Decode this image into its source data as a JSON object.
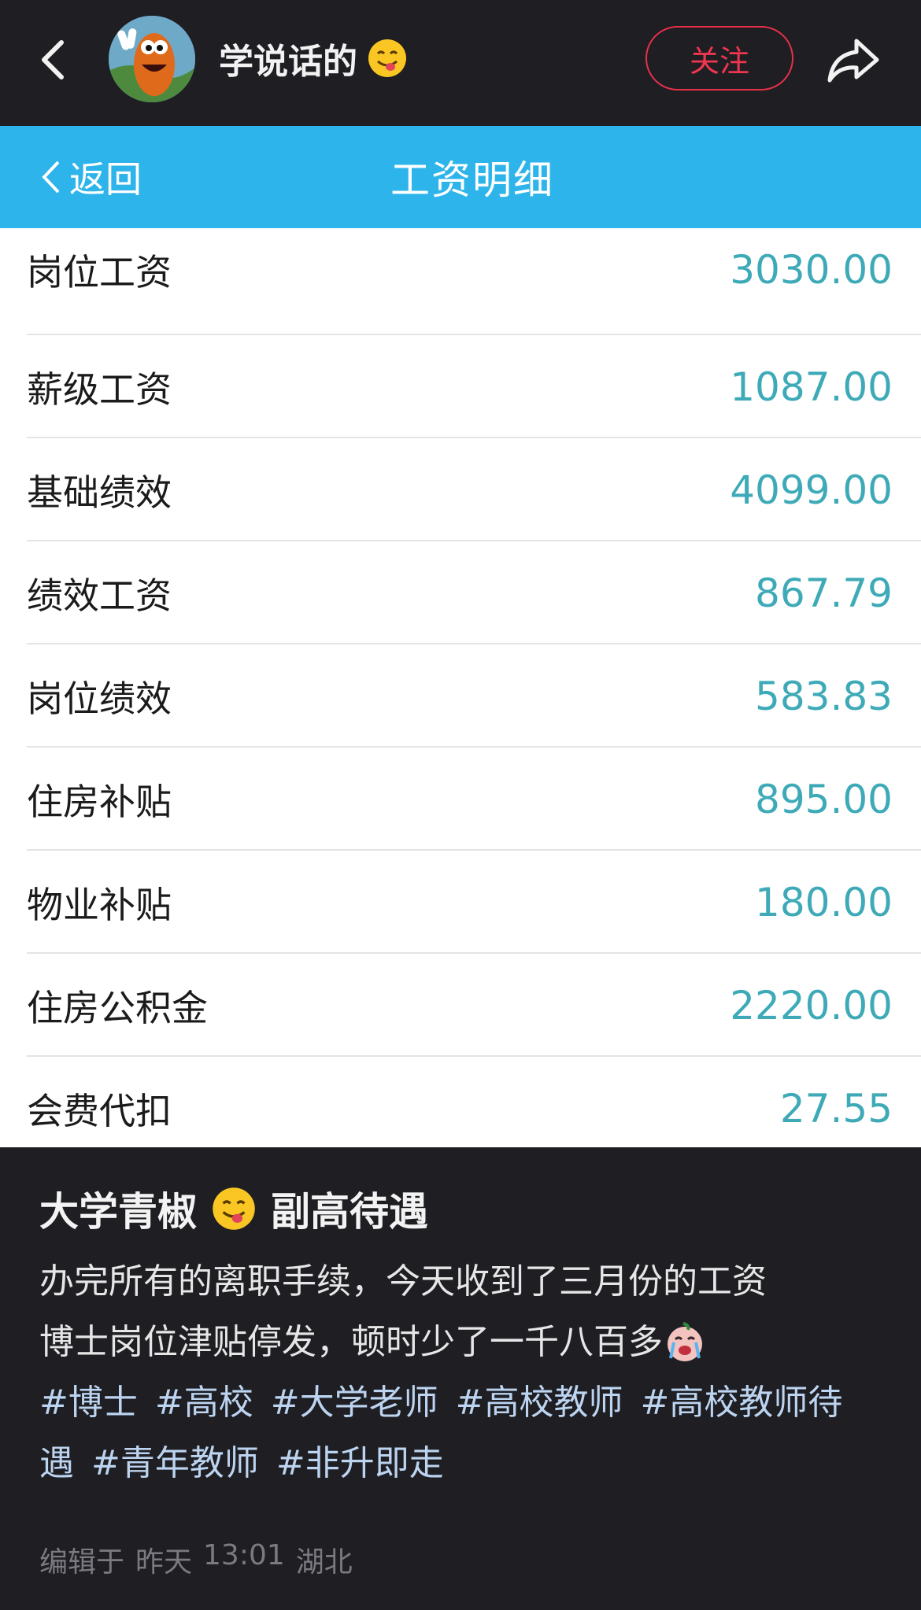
{
  "topbar": {
    "username": "学说话的",
    "follow_label": "关注"
  },
  "screenshot": {
    "back_label": "返回",
    "title": "工资明细",
    "rows": [
      {
        "label": "岗位工资",
        "value": "3030.00"
      },
      {
        "label": "薪级工资",
        "value": "1087.00"
      },
      {
        "label": "基础绩效",
        "value": "4099.00"
      },
      {
        "label": "绩效工资",
        "value": "867.79"
      },
      {
        "label": "岗位绩效",
        "value": "583.83"
      },
      {
        "label": "住房补贴",
        "value": "895.00"
      },
      {
        "label": "物业补贴",
        "value": "180.00"
      },
      {
        "label": "住房公积金",
        "value": "2220.00"
      },
      {
        "label": "会费代扣",
        "value": "27.55"
      }
    ]
  },
  "post": {
    "title_part1": "大学青椒",
    "title_part2": "副高待遇",
    "line1": "办完所有的离职手续，今天收到了三月份的工资",
    "line2": "博士岗位津贴停发，顿时少了一千八百多",
    "tags": [
      "#博士",
      "#高校",
      "#大学老师",
      "#高校教师",
      "#高校教师待",
      "遇",
      "#青年教师",
      "#非升即走"
    ],
    "meta_prefix": "编辑于",
    "meta_day": "昨天",
    "meta_time": "13:01",
    "meta_location": "湖北"
  },
  "colors": {
    "background": "#1e1e23",
    "follow_red": "#f0364f",
    "header_blue": "#2db4ea",
    "value_teal": "#3eaab8",
    "hashtag": "#bcd4f0"
  },
  "icons": [
    "chevron-left-icon",
    "avatar",
    "smiley-tongue-icon",
    "share-arrow-icon",
    "crying-face-icon"
  ]
}
